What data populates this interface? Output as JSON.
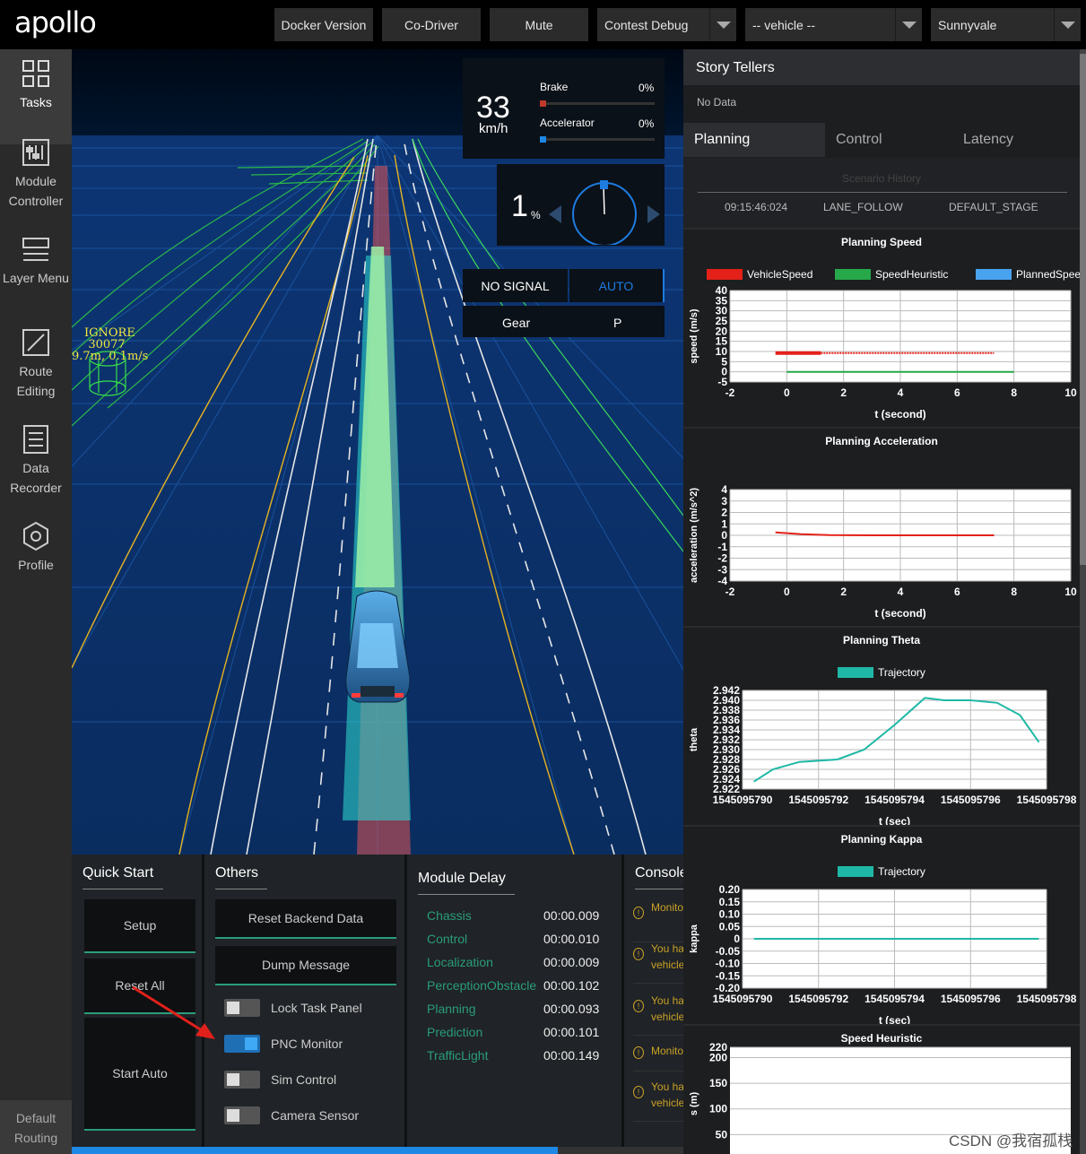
{
  "app": {
    "logo": "apollo",
    "watermark": "CSDN @我宿孤栈"
  },
  "topbar": {
    "docker_label": "Docker Version",
    "codriver_label": "Co-Driver",
    "mute_label": "Mute",
    "mode_select": "Contest Debug",
    "vehicle_select": "-- vehicle --",
    "map_select": "Sunnyvale"
  },
  "sidebar": {
    "items": [
      {
        "label": "Tasks",
        "icon": "tasks-icon"
      },
      {
        "label": "Module Controller",
        "icon": "module-controller-icon"
      },
      {
        "label": "Layer Menu",
        "icon": "layer-menu-icon"
      },
      {
        "label": "Route Editing",
        "icon": "route-editing-icon"
      },
      {
        "label": "Data Recorder",
        "icon": "data-recorder-icon"
      },
      {
        "label": "Profile",
        "icon": "profile-icon"
      }
    ],
    "default_routing": "Default Routing"
  },
  "dashboard": {
    "speed": "33",
    "speed_unit": "km/h",
    "brake_label": "Brake",
    "brake_value": "0%",
    "brake_fraction": 0,
    "accel_label": "Accelerator",
    "accel_value": "0%",
    "accel_fraction": 0,
    "steering": "1",
    "steering_unit": "%",
    "signal": "NO SIGNAL",
    "drive_mode": "AUTO",
    "gear_label": "Gear",
    "gear_value": "P"
  },
  "scene": {
    "obstacle_tag": "IGNORE",
    "obstacle_id": "30077",
    "obstacle_info": "9.7m, 0.1m/s"
  },
  "quick_start": {
    "title": "Quick Start",
    "setup": "Setup",
    "reset_all": "Reset All",
    "start_auto": "Start Auto"
  },
  "others": {
    "title": "Others",
    "reset_backend": "Reset Backend Data",
    "dump_message": "Dump Message",
    "toggles": [
      {
        "label": "Lock Task Panel",
        "on": false
      },
      {
        "label": "PNC Monitor",
        "on": true
      },
      {
        "label": "Sim Control",
        "on": false
      },
      {
        "label": "Camera Sensor",
        "on": false
      }
    ]
  },
  "module_delay": {
    "title": "Module Delay",
    "rows": [
      {
        "name": "Chassis",
        "value": "00:00.009"
      },
      {
        "name": "Control",
        "value": "00:00.010"
      },
      {
        "name": "Localization",
        "value": "00:00.009"
      },
      {
        "name": "PerceptionObstacle",
        "value": "00:00.102"
      },
      {
        "name": "Planning",
        "value": "00:00.093"
      },
      {
        "name": "Prediction",
        "value": "00:00.101"
      },
      {
        "name": "TrafficLight",
        "value": "00:00.149"
      }
    ]
  },
  "console": {
    "title": "Console",
    "rows": [
      {
        "text": "Monito"
      },
      {
        "text": "You ha",
        "text2": "vehicle"
      },
      {
        "text": "You ha",
        "text2": "vehicle"
      },
      {
        "text": "Monito"
      },
      {
        "text": "You ha",
        "text2": "vehicle"
      }
    ]
  },
  "right": {
    "title": "Story Tellers",
    "no_data": "No Data",
    "tabs": [
      "Planning",
      "Control",
      "Latency"
    ],
    "active_tab": "Planning",
    "scenario": {
      "title": "Scenario History",
      "time": "09:15:46:024",
      "scenario": "LANE_FOLLOW",
      "stage": "DEFAULT_STAGE"
    }
  },
  "chart_data": [
    {
      "type": "line",
      "title": "Planning Speed",
      "xlabel": "t (second)",
      "ylabel": "speed (m/s)",
      "xlim": [
        -2,
        10
      ],
      "ylim": [
        -5,
        40
      ],
      "xticks": [
        "-2",
        "0",
        "2",
        "4",
        "6",
        "8",
        "10"
      ],
      "yticks": [
        "-5",
        "0",
        "5",
        "10",
        "15",
        "20",
        "25",
        "30",
        "35",
        "40"
      ],
      "series": [
        {
          "name": "VehicleSpeed",
          "color": "#e32119",
          "x": [
            -0.4,
            1.2
          ],
          "y": [
            9.2,
            9.2
          ]
        },
        {
          "name": "SpeedHeuristic",
          "color": "#27a84a",
          "x": [
            0,
            8
          ],
          "y": [
            0,
            0
          ]
        },
        {
          "name": "PlannedSpeed",
          "color": "#4aa3ef",
          "x": [
            1.2,
            7.3
          ],
          "y": [
            9.2,
            9.2
          ]
        }
      ]
    },
    {
      "type": "line",
      "title": "Planning Acceleration",
      "xlabel": "t (second)",
      "ylabel": "acceleration (m/s^2)",
      "xlim": [
        -2,
        10
      ],
      "ylim": [
        -4,
        4
      ],
      "xticks": [
        "-2",
        "0",
        "2",
        "4",
        "6",
        "8",
        "10"
      ],
      "yticks": [
        "-4",
        "-3",
        "-2",
        "-1",
        "0",
        "1",
        "2",
        "3",
        "4"
      ],
      "series": [
        {
          "name": "",
          "color": "#e32119",
          "x": [
            -0.4,
            0.5,
            1.5,
            3,
            5,
            7.3
          ],
          "y": [
            0.25,
            0.1,
            0.02,
            0,
            0,
            0
          ]
        }
      ]
    },
    {
      "type": "line",
      "title": "Planning Theta",
      "xlabel": "t (sec)",
      "ylabel": "theta",
      "xlim": [
        1545095790,
        1545095798
      ],
      "ylim": [
        2.922,
        2.942
      ],
      "xticks": [
        "1545095790",
        "1545095792",
        "1545095794",
        "1545095796",
        "1545095798"
      ],
      "yticks": [
        "2.922",
        "2.924",
        "2.926",
        "2.928",
        "2.930",
        "2.932",
        "2.934",
        "2.936",
        "2.938",
        "2.940",
        "2.942"
      ],
      "series": [
        {
          "name": "Trajectory",
          "color": "#1fb8a6",
          "x": [
            1545095790.3,
            1545095790.8,
            1545095791.5,
            1545095792.5,
            1545095793.2,
            1545095794,
            1545095794.8,
            1545095795.3,
            1545095796,
            1545095796.7,
            1545095797.3,
            1545095797.8
          ],
          "y": [
            2.9235,
            2.926,
            2.9275,
            2.928,
            2.93,
            2.935,
            2.9405,
            2.94,
            2.94,
            2.9395,
            2.937,
            2.9315
          ]
        }
      ]
    },
    {
      "type": "line",
      "title": "Planning Kappa",
      "xlabel": "t (sec)",
      "ylabel": "kappa",
      "xlim": [
        1545095790,
        1545095798
      ],
      "ylim": [
        -0.2,
        0.2
      ],
      "xticks": [
        "1545095790",
        "1545095792",
        "1545095794",
        "1545095796",
        "1545095798"
      ],
      "yticks": [
        "-0.20",
        "-0.15",
        "-0.10",
        "-0.05",
        "0",
        "0.05",
        "0.10",
        "0.15",
        "0.20"
      ],
      "series": [
        {
          "name": "Trajectory",
          "color": "#1fb8a6",
          "x": [
            1545095790.3,
            1545095794,
            1545095797.8
          ],
          "y": [
            0,
            0,
            0
          ]
        }
      ]
    },
    {
      "type": "line",
      "title": "Speed Heuristic",
      "xlabel": "",
      "ylabel": "s (m)",
      "ylim": [
        0,
        220
      ],
      "yticks": [
        "50",
        "100",
        "150",
        "200",
        "220"
      ],
      "series": []
    }
  ]
}
